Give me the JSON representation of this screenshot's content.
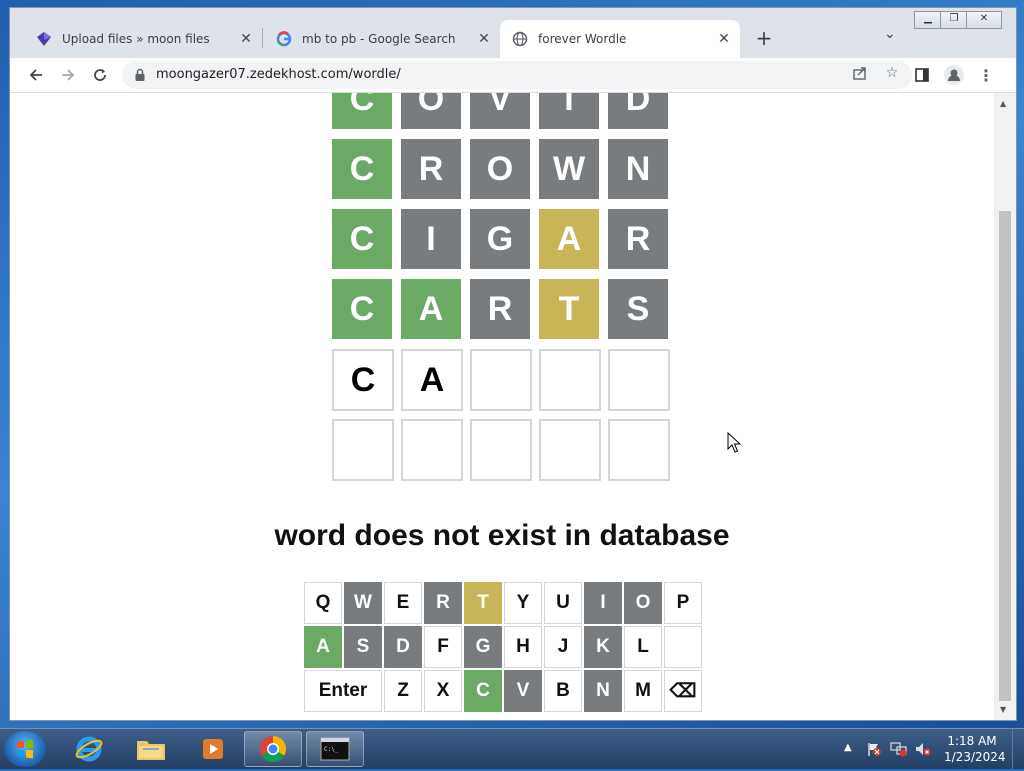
{
  "browser": {
    "tabs": [
      {
        "title": "Upload files » moon files",
        "active": false
      },
      {
        "title": "mb to pb - Google Search",
        "active": false
      },
      {
        "title": "forever Wordle",
        "active": true
      }
    ],
    "url": "moongazer07.zedekhost.com/wordle/"
  },
  "board": {
    "rows": [
      [
        {
          "letter": "C",
          "state": "green"
        },
        {
          "letter": "O",
          "state": "gray"
        },
        {
          "letter": "V",
          "state": "gray"
        },
        {
          "letter": "I",
          "state": "gray"
        },
        {
          "letter": "D",
          "state": "gray"
        }
      ],
      [
        {
          "letter": "C",
          "state": "green"
        },
        {
          "letter": "R",
          "state": "gray"
        },
        {
          "letter": "O",
          "state": "gray"
        },
        {
          "letter": "W",
          "state": "gray"
        },
        {
          "letter": "N",
          "state": "gray"
        }
      ],
      [
        {
          "letter": "C",
          "state": "green"
        },
        {
          "letter": "I",
          "state": "gray"
        },
        {
          "letter": "G",
          "state": "gray"
        },
        {
          "letter": "A",
          "state": "yellow"
        },
        {
          "letter": "R",
          "state": "gray"
        }
      ],
      [
        {
          "letter": "C",
          "state": "green"
        },
        {
          "letter": "A",
          "state": "green"
        },
        {
          "letter": "R",
          "state": "gray"
        },
        {
          "letter": "T",
          "state": "yellow"
        },
        {
          "letter": "S",
          "state": "gray"
        }
      ],
      [
        {
          "letter": "C",
          "state": "filled"
        },
        {
          "letter": "A",
          "state": "filled"
        },
        {
          "letter": "",
          "state": "empty"
        },
        {
          "letter": "",
          "state": "empty"
        },
        {
          "letter": "",
          "state": "empty"
        }
      ],
      [
        {
          "letter": "",
          "state": "empty"
        },
        {
          "letter": "",
          "state": "empty"
        },
        {
          "letter": "",
          "state": "empty"
        },
        {
          "letter": "",
          "state": "empty"
        },
        {
          "letter": "",
          "state": "empty"
        }
      ]
    ]
  },
  "message": "word does not exist in database",
  "keyboard": {
    "rows": [
      [
        {
          "label": "Q",
          "state": "none"
        },
        {
          "label": "W",
          "state": "gray"
        },
        {
          "label": "E",
          "state": "none"
        },
        {
          "label": "R",
          "state": "gray"
        },
        {
          "label": "T",
          "state": "yellow"
        },
        {
          "label": "Y",
          "state": "none"
        },
        {
          "label": "U",
          "state": "none"
        },
        {
          "label": "I",
          "state": "gray"
        },
        {
          "label": "O",
          "state": "gray"
        },
        {
          "label": "P",
          "state": "none"
        }
      ],
      [
        {
          "label": "A",
          "state": "green"
        },
        {
          "label": "S",
          "state": "gray"
        },
        {
          "label": "D",
          "state": "gray"
        },
        {
          "label": "F",
          "state": "none"
        },
        {
          "label": "G",
          "state": "gray"
        },
        {
          "label": "H",
          "state": "none"
        },
        {
          "label": "J",
          "state": "none"
        },
        {
          "label": "K",
          "state": "gray"
        },
        {
          "label": "L",
          "state": "none"
        },
        {
          "label": "",
          "state": "none"
        }
      ],
      [
        {
          "label": "Enter",
          "state": "none"
        },
        {
          "label": "Z",
          "state": "none"
        },
        {
          "label": "X",
          "state": "none"
        },
        {
          "label": "C",
          "state": "green"
        },
        {
          "label": "V",
          "state": "gray"
        },
        {
          "label": "B",
          "state": "none"
        },
        {
          "label": "N",
          "state": "gray"
        },
        {
          "label": "M",
          "state": "none"
        },
        {
          "label": "⌫",
          "state": "none"
        }
      ]
    ]
  },
  "taskbar": {
    "time": "1:18 AM",
    "date": "1/23/2024"
  },
  "colors": {
    "green": "#6aaa64",
    "yellow": "#c9b458",
    "gray": "#787c7e"
  }
}
